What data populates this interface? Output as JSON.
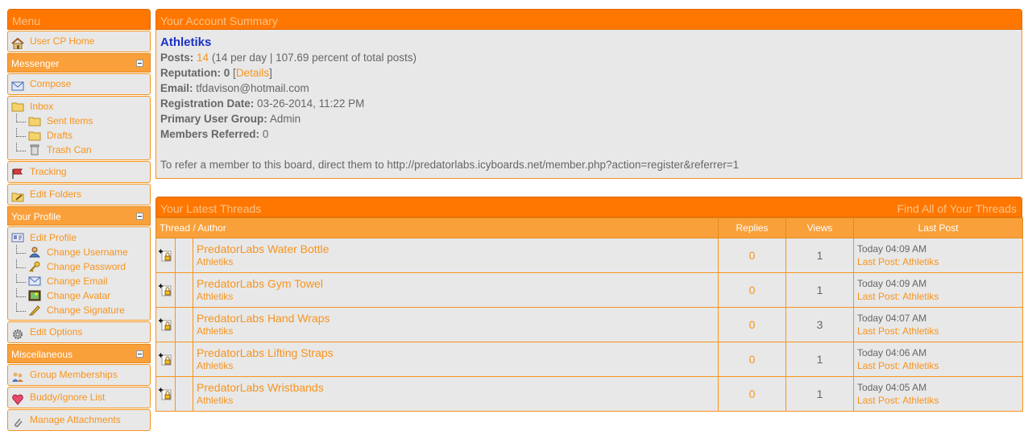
{
  "menu": {
    "title": "Menu",
    "home": "User CP Home",
    "messenger": {
      "title": "Messenger",
      "compose": "Compose",
      "inbox": "Inbox",
      "sent": "Sent Items",
      "drafts": "Drafts",
      "trash": "Trash Can",
      "tracking": "Tracking",
      "edit_folders": "Edit Folders"
    },
    "profile": {
      "title": "Your Profile",
      "edit_profile": "Edit Profile",
      "change_username": "Change Username",
      "change_password": "Change Password",
      "change_email": "Change Email",
      "change_avatar": "Change Avatar",
      "change_signature": "Change Signature",
      "edit_options": "Edit Options"
    },
    "misc": {
      "title": "Miscellaneous",
      "group_memberships": "Group Memberships",
      "buddy_list": "Buddy/Ignore List",
      "manage_attachments": "Manage Attachments"
    }
  },
  "summary": {
    "title": "Your Account Summary",
    "username": "Athletiks",
    "posts_label": "Posts:",
    "posts_count": "14",
    "posts_detail": "(14 per day | 107.69 percent of total posts)",
    "reputation_label": "Reputation:",
    "reputation_value": "0",
    "details_open": "[",
    "details_link": "Details",
    "details_close": "]",
    "email_label": "Email:",
    "email_value": "tfdavison@hotmail.com",
    "regdate_label": "Registration Date:",
    "regdate_value": "03-26-2014, 11:22 PM",
    "group_label": "Primary User Group:",
    "group_value": "Admin",
    "referred_label": "Members Referred:",
    "referred_value": "0",
    "refer_text": "To refer a member to this board, direct them to http://predatorlabs.icyboards.net/member.php?action=register&referrer=1"
  },
  "threads": {
    "title": "Your Latest Threads",
    "find_all": "Find All of Your Threads",
    "columns": {
      "thread_author": "Thread / Author",
      "replies": "Replies",
      "views": "Views",
      "last_post": "Last Post"
    },
    "rows": [
      {
        "title": "PredatorLabs Water Bottle",
        "author": "Athletiks",
        "replies": "0",
        "views": "1",
        "time": "Today 04:09 AM",
        "last_post": "Last Post: Athletiks"
      },
      {
        "title": "PredatorLabs Gym Towel",
        "author": "Athletiks",
        "replies": "0",
        "views": "1",
        "time": "Today 04:09 AM",
        "last_post": "Last Post: Athletiks"
      },
      {
        "title": "PredatorLabs Hand Wraps",
        "author": "Athletiks",
        "replies": "0",
        "views": "3",
        "time": "Today 04:07 AM",
        "last_post": "Last Post: Athletiks"
      },
      {
        "title": "PredatorLabs Lifting Straps",
        "author": "Athletiks",
        "replies": "0",
        "views": "1",
        "time": "Today 04:06 AM",
        "last_post": "Last Post: Athletiks"
      },
      {
        "title": "PredatorLabs Wristbands",
        "author": "Athletiks",
        "replies": "0",
        "views": "1",
        "time": "Today 04:05 AM",
        "last_post": "Last Post: Athletiks"
      }
    ]
  },
  "colors": {
    "header": "#ff7700",
    "subheader": "#f9a03a",
    "link": "#f7941d",
    "username": "#1a32c8",
    "panel_bg": "#e8e8e8"
  }
}
